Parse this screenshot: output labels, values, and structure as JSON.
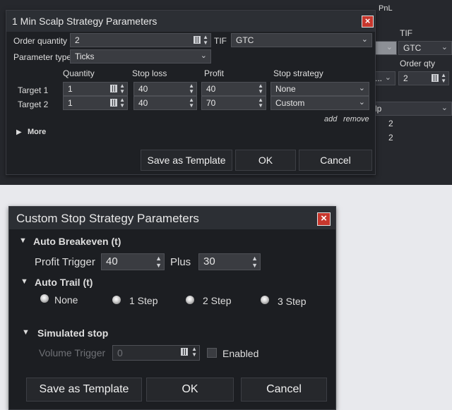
{
  "background": {
    "header_pnl": "PnL",
    "tif_label": "TIF",
    "tif_value": "GTC",
    "order_qty_label": "Order qty",
    "order_qty_value": "2",
    "combo_partial": "...",
    "row_partial": "lp",
    "row_value_1": "2",
    "row_value_2": "2"
  },
  "scalp_dialog": {
    "title": "1 Min Scalp  Strategy Parameters",
    "order_quantity_label": "Order quantity",
    "order_quantity_value": "2",
    "tif_label": "TIF",
    "tif_value": "GTC",
    "parameter_type_label": "Parameter type",
    "parameter_type_value": "Ticks",
    "columns": [
      "Quantity",
      "Stop loss",
      "Profit",
      "Stop strategy"
    ],
    "targets": [
      {
        "label": "Target 1",
        "quantity": "1",
        "stop_loss": "40",
        "profit": "40",
        "stop_strategy": "None"
      },
      {
        "label": "Target 2",
        "quantity": "1",
        "stop_loss": "40",
        "profit": "70",
        "stop_strategy": "Custom"
      }
    ],
    "add_label": "add",
    "remove_label": "remove",
    "more_label": "More",
    "save_template_label": "Save as Template",
    "ok_label": "OK",
    "cancel_label": "Cancel"
  },
  "custom_dialog": {
    "title": "Custom Stop Strategy Parameters",
    "auto_breakeven_label": "Auto Breakeven (t)",
    "profit_trigger_label": "Profit Trigger",
    "profit_trigger_value": "40",
    "plus_label": "Plus",
    "plus_value": "30",
    "auto_trail_label": "Auto Trail (t)",
    "trail_options": [
      "None",
      "1 Step",
      "2 Step",
      "3 Step"
    ],
    "trail_selected": "None",
    "simulated_stop_label": "Simulated stop",
    "volume_trigger_label": "Volume Trigger",
    "volume_trigger_value": "0",
    "enabled_label": "Enabled",
    "enabled_checked": false,
    "save_template_label": "Save as Template",
    "ok_label": "OK",
    "cancel_label": "Cancel"
  }
}
